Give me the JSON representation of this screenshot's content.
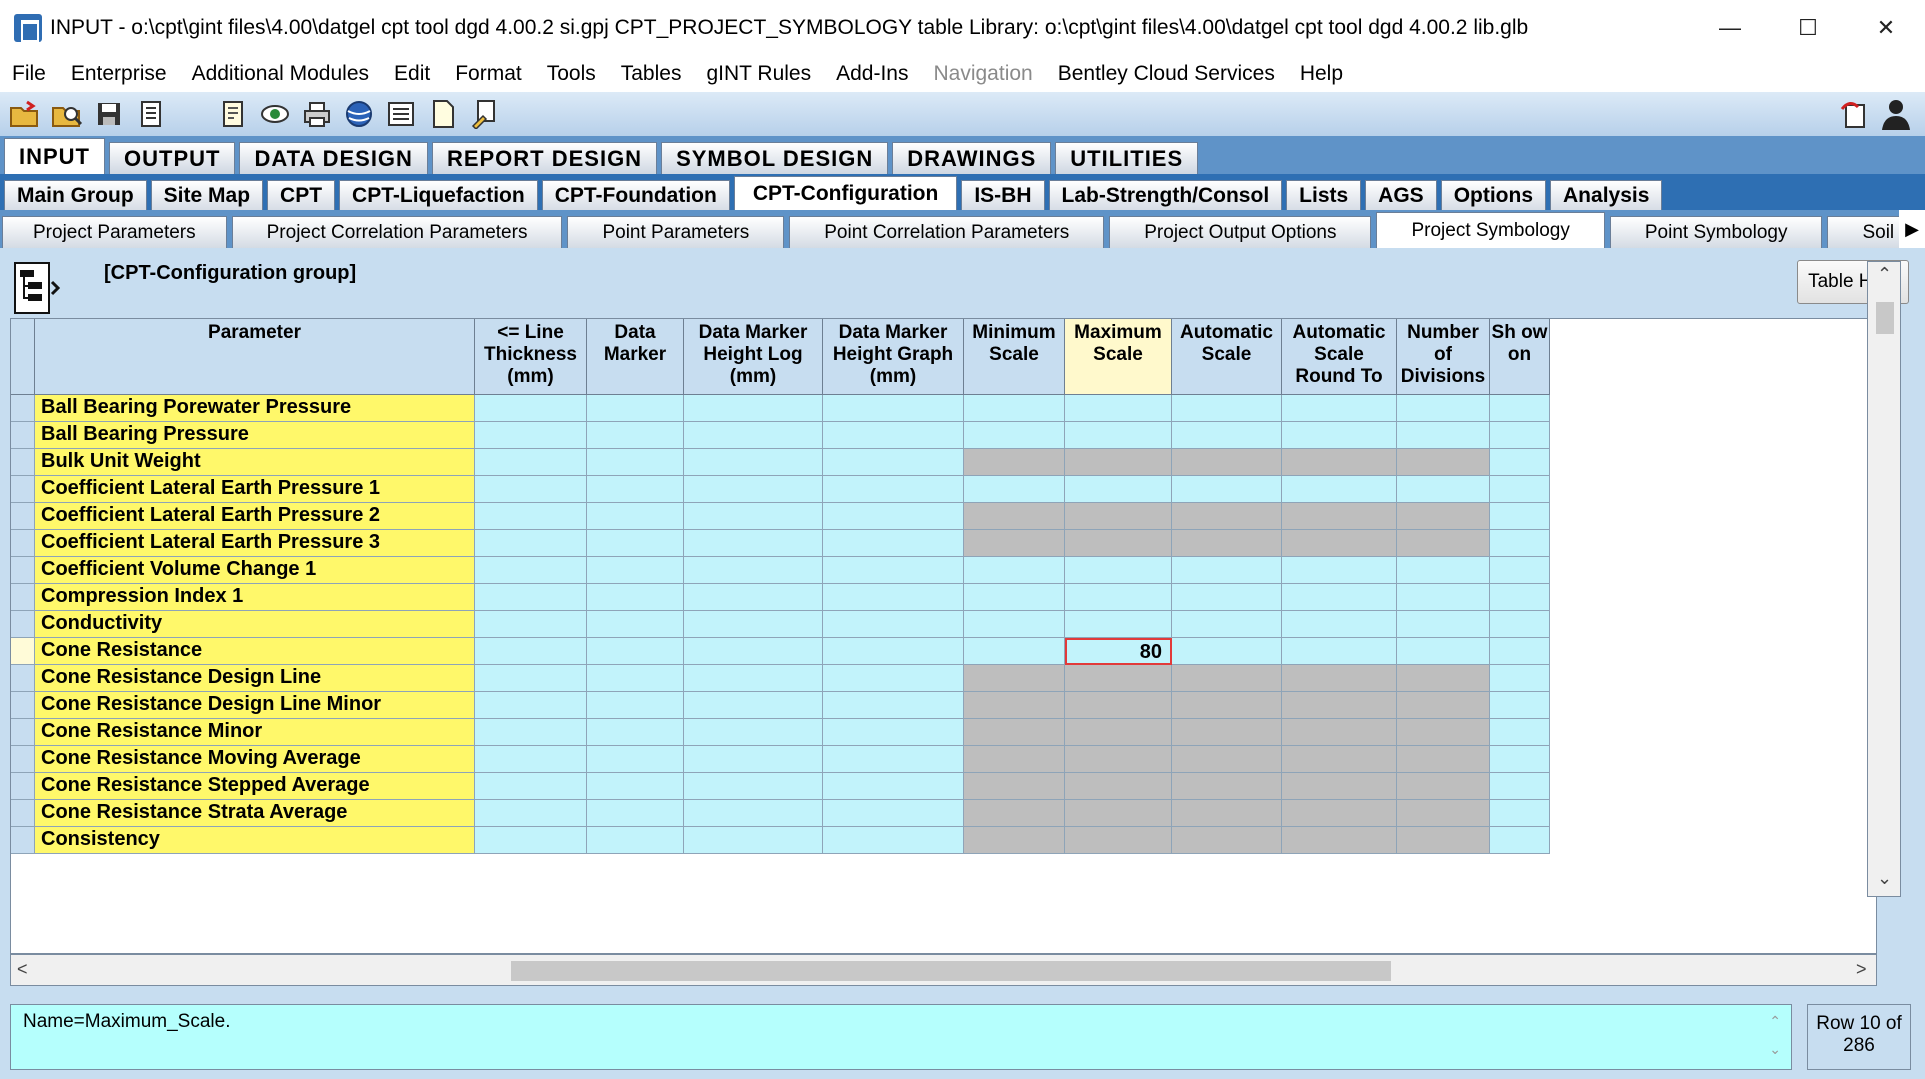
{
  "window": {
    "title": "INPUT -  o:\\cpt\\gint files\\4.00\\datgel cpt tool dgd 4.00.2 si.gpj  CPT_PROJECT_SYMBOLOGY table  Library: o:\\cpt\\gint files\\4.00\\datgel cpt tool dgd 4.00.2 lib.glb",
    "minimize": "—",
    "maximize": "☐",
    "close": "✕"
  },
  "menu": [
    {
      "label": "File"
    },
    {
      "label": "Enterprise"
    },
    {
      "label": "Additional Modules"
    },
    {
      "label": "Edit"
    },
    {
      "label": "Format"
    },
    {
      "label": "Tools"
    },
    {
      "label": "Tables"
    },
    {
      "label": "gINT Rules"
    },
    {
      "label": "Add-Ins"
    },
    {
      "label": "Navigation"
    },
    {
      "label": "Bentley Cloud Services"
    },
    {
      "label": "Help"
    }
  ],
  "toolbar_icons": [
    "open-folder-icon",
    "preview-icon",
    "save-icon",
    "properties-icon",
    "report-icon",
    "view-eye-icon",
    "print-icon",
    "globe-icon",
    "list-icon",
    "new-page-icon",
    "edit-document-icon"
  ],
  "module_tabs": [
    "INPUT",
    "OUTPUT",
    "DATA DESIGN",
    "REPORT DESIGN",
    "SYMBOL DESIGN",
    "DRAWINGS",
    "UTILITIES"
  ],
  "group_tabs": [
    "Main Group",
    "Site Map",
    "CPT",
    "CPT-Liquefaction",
    "CPT-Foundation",
    "CPT-Configuration",
    "IS-BH",
    "Lab-Strength/Consol",
    "Lists",
    "AGS",
    "Options",
    "Analysis"
  ],
  "table_tabs": [
    "Project Parameters",
    "Project Correlation Parameters",
    "Point Parameters",
    "Point Correlation Parameters",
    "Project Output Options",
    "Project Symbology",
    "Point Symbology",
    "Soil Class Met"
  ],
  "group_label": "[CPT-Configuration group]",
  "table_help": "Table Help",
  "columns": [
    {
      "label": "Parameter"
    },
    {
      "label": "<= Line Thickness (mm)"
    },
    {
      "label": "Data Marker"
    },
    {
      "label": "Data Marker Height Log (mm)"
    },
    {
      "label": "Data Marker Height Graph (mm)"
    },
    {
      "label": "Minimum Scale"
    },
    {
      "label": "Maximum Scale"
    },
    {
      "label": "Automatic Scale"
    },
    {
      "label": "Automatic Scale Round To"
    },
    {
      "label": "Number of Divisions"
    },
    {
      "label": "Sh ow on"
    }
  ],
  "rows": [
    {
      "name": "Ball Bearing Porewater Pressure",
      "gray": false
    },
    {
      "name": "Ball Bearing Pressure",
      "gray": false
    },
    {
      "name": "Bulk Unit Weight",
      "gray": true
    },
    {
      "name": "Coefficient Lateral Earth Pressure 1",
      "gray": false
    },
    {
      "name": "Coefficient Lateral Earth Pressure 2",
      "gray": true
    },
    {
      "name": "Coefficient Lateral Earth Pressure 3",
      "gray": true
    },
    {
      "name": "Coefficient Volume Change 1",
      "gray": false
    },
    {
      "name": "Compression Index 1",
      "gray": false
    },
    {
      "name": "Conductivity",
      "gray": false
    },
    {
      "name": "Cone Resistance",
      "gray": false,
      "max_scale": "80"
    },
    {
      "name": "Cone Resistance Design Line",
      "gray": true
    },
    {
      "name": "Cone Resistance Design Line Minor",
      "gray": true
    },
    {
      "name": "Cone Resistance Minor",
      "gray": true
    },
    {
      "name": "Cone Resistance Moving Average",
      "gray": true
    },
    {
      "name": "Cone Resistance Stepped Average",
      "gray": true
    },
    {
      "name": "Cone Resistance Strata Average",
      "gray": true
    },
    {
      "name": "Consistency",
      "gray": true
    }
  ],
  "status_text": "Name=Maximum_Scale.",
  "row_info": "Row 10 of 286",
  "colors": {
    "param_cell": "#fff86a",
    "data_cell": "#c2f3fb",
    "disabled_cell": "#bebebe",
    "status_bg": "#b5fffd"
  }
}
